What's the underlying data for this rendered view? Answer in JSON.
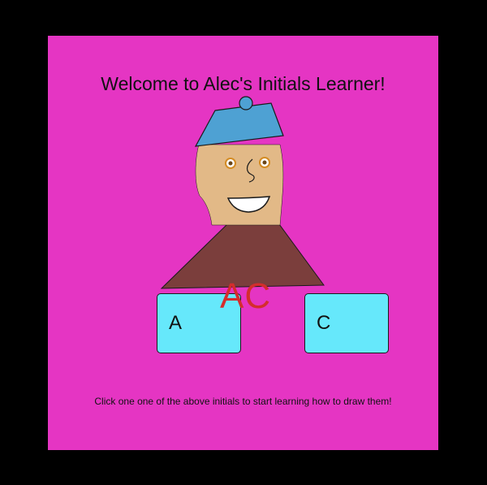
{
  "app": {
    "title": "Welcome to Alec's Initials Learner!",
    "instructions": "Click one one of the above initials to start learning how to draw them!"
  },
  "initials_overlay": "AC",
  "buttons": [
    {
      "label": "A"
    },
    {
      "label": "C"
    }
  ],
  "colors": {
    "background": "#000000",
    "canvas": "#e535c3",
    "hat": "#4ea1d3",
    "face": "#e2b987",
    "body": "#7b3e3c",
    "button": "#66e8fb",
    "initials_overlay": "#d42d2d"
  }
}
